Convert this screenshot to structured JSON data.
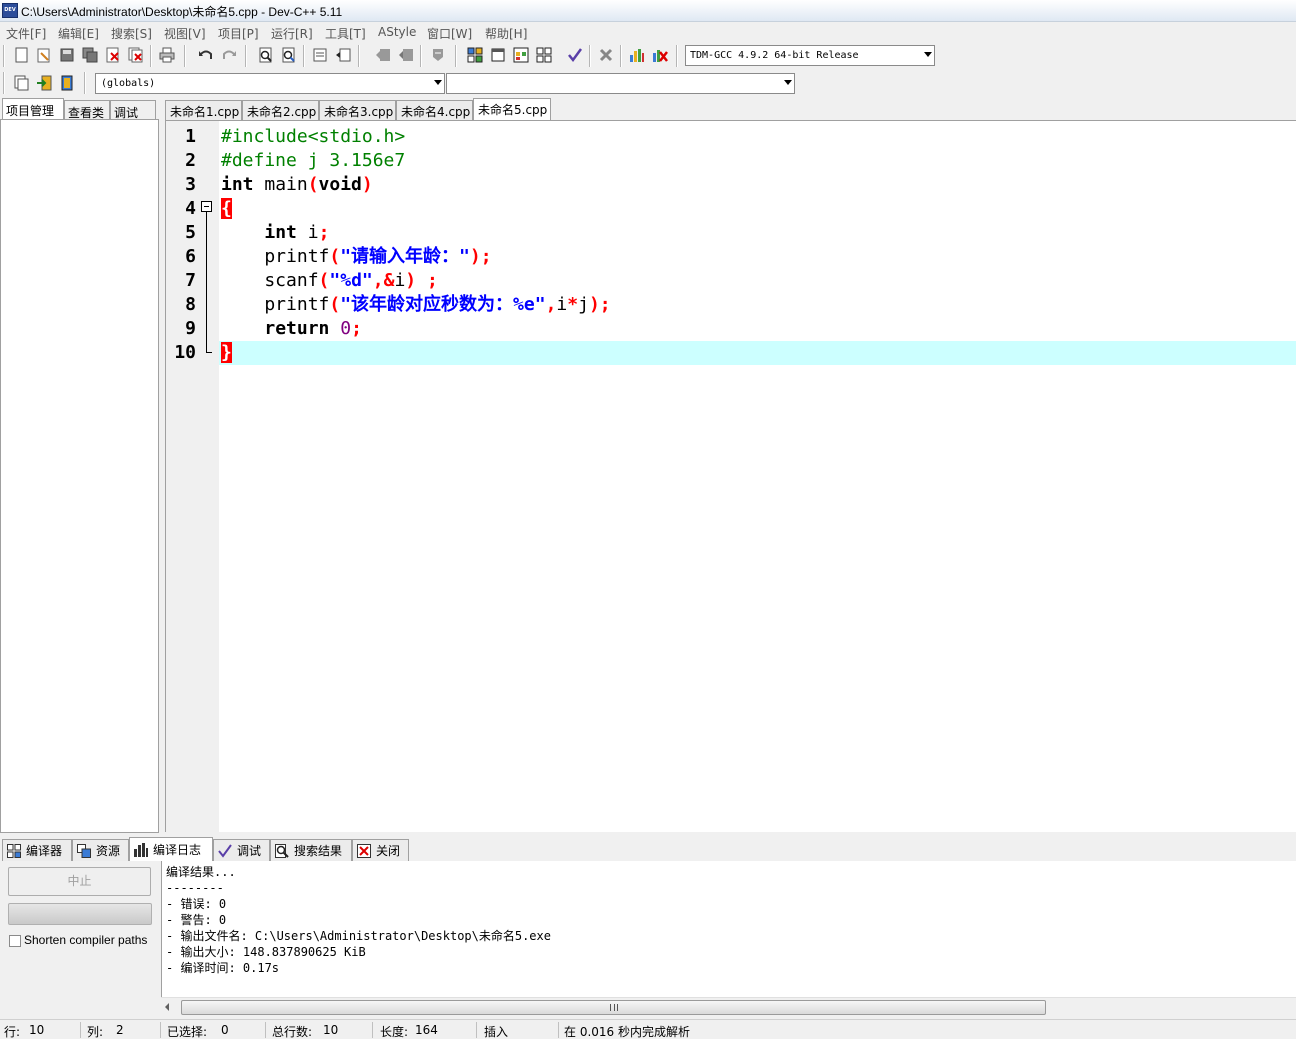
{
  "window": {
    "title": "C:\\Users\\Administrator\\Desktop\\未命名5.cpp - Dev-C++ 5.11",
    "icon_text": "DEV"
  },
  "menu": [
    "文件[F]",
    "编辑[E]",
    "搜索[S]",
    "视图[V]",
    "项目[P]",
    "运行[R]",
    "工具[T]",
    "AStyle",
    "窗口[W]",
    "帮助[H]"
  ],
  "toolbar": {
    "compiler": "TDM-GCC 4.9.2 64-bit Release",
    "scope": "(globals)"
  },
  "left_tabs": [
    "项目管理",
    "查看类",
    "调试"
  ],
  "editor_tabs": [
    "未命名1.cpp",
    "未命名2.cpp",
    "未命名3.cpp",
    "未命名4.cpp",
    "未命名5.cpp"
  ],
  "active_editor_tab": 4,
  "code": {
    "line_numbers": [
      "1",
      "2",
      "3",
      "4",
      "5",
      "6",
      "7",
      "8",
      "9",
      "10"
    ],
    "lines": [
      "#include<stdio.h>",
      "#define j 3.156e7",
      "int main(void)",
      "{",
      "    int i;",
      "    printf(\"请输入年龄：\");",
      "    scanf(\"%d\",&i) ;",
      "    printf(\"该年龄对应秒数为：%e\",i*j);",
      "    return 0;",
      "}"
    ]
  },
  "bottom_tabs": [
    "编译器",
    "资源",
    "编译日志",
    "调试",
    "搜索结果",
    "关闭"
  ],
  "bottom_icons": [
    "grid-icon",
    "resources-icon",
    "bar-chart-icon",
    "check-icon",
    "search-icon",
    "close-icon"
  ],
  "compile_panel": {
    "stop_label": "中止",
    "shorten_label": "Shorten compiler paths"
  },
  "log": [
    "编译结果...",
    "--------",
    "- 错误: 0",
    "- 警告: 0",
    "- 输出文件名: C:\\Users\\Administrator\\Desktop\\未命名5.exe",
    "- 输出大小: 148.837890625 KiB",
    "- 编译时间: 0.17s"
  ],
  "status": {
    "row_label": "行:",
    "row": "10",
    "col_label": "列:",
    "col": "2",
    "sel_label": "已选择:",
    "sel": "0",
    "total_label": "总行数:",
    "total": "10",
    "len_label": "长度:",
    "len": "164",
    "mode": "插入",
    "parse": "在 0.016 秒内完成解析"
  },
  "colors": {
    "preprocessor": "#008000",
    "string": "#0000ff",
    "symbol": "#ff0000",
    "number": "#800080",
    "current_line": "#ccffff"
  }
}
